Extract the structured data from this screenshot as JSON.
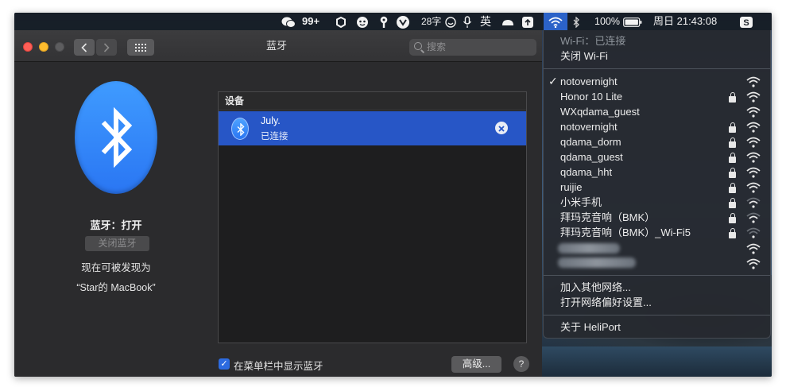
{
  "menubar": {
    "wechat_badge": "99+",
    "temperature": "28字",
    "input_method": "英",
    "battery": "100%",
    "clock": "周日 21:43:08"
  },
  "window": {
    "title": "蓝牙",
    "search_placeholder": "搜索"
  },
  "bluetooth": {
    "status": "蓝牙：打开",
    "toggle_label": "关闭蓝牙",
    "discoverable": "现在可被发现为",
    "device_name": "“Star的 MacBook”"
  },
  "devices": {
    "header": "设备",
    "items": [
      {
        "name": "July.",
        "status": "已连接"
      }
    ]
  },
  "footer": {
    "show_in_menubar": "在菜单栏中显示蓝牙",
    "advanced": "高级...",
    "help": "?"
  },
  "wifi_menu": {
    "status": "Wi-Fi：已连接",
    "turn_off": "关闭 Wi-Fi",
    "networks": [
      {
        "name": "notovernight",
        "connected": true,
        "locked": false,
        "strength": 3
      },
      {
        "name": "Honor 10 Lite",
        "connected": false,
        "locked": true,
        "strength": 3
      },
      {
        "name": "WXqdama_guest",
        "connected": false,
        "locked": false,
        "strength": 3
      },
      {
        "name": "notovernight",
        "connected": false,
        "locked": true,
        "strength": 3
      },
      {
        "name": "qdama_dorm",
        "connected": false,
        "locked": true,
        "strength": 3
      },
      {
        "name": "qdama_guest",
        "connected": false,
        "locked": true,
        "strength": 3
      },
      {
        "name": "qdama_hht",
        "connected": false,
        "locked": true,
        "strength": 3
      },
      {
        "name": "ruijie",
        "connected": false,
        "locked": true,
        "strength": 3
      },
      {
        "name": "小米手机",
        "connected": false,
        "locked": true,
        "strength": 2
      },
      {
        "name": "拜玛克音响（BMK）",
        "connected": false,
        "locked": true,
        "strength": 2
      },
      {
        "name": "拜玛克音响（BMK）_Wi-Fi5",
        "connected": false,
        "locked": true,
        "strength": 1
      }
    ],
    "join_other": "加入其他网络...",
    "open_prefs": "打开网络偏好设置...",
    "about": "关于 HeliPort"
  },
  "colors": {
    "accent": "#2756c6",
    "bluetooth_blue": "#2a76f3",
    "close": "#fe5f57",
    "minimize": "#febc2e"
  }
}
